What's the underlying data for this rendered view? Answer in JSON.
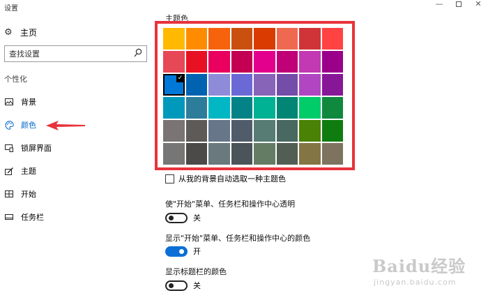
{
  "window": {
    "title": "设置",
    "controls": {
      "minimize": "—",
      "close": "✕"
    }
  },
  "sidebar": {
    "home": {
      "icon": "gear-icon",
      "label": "主页"
    },
    "search": {
      "placeholder": "查找设置",
      "icon": "search-icon"
    },
    "section": "个性化",
    "items": [
      {
        "icon": "picture-icon",
        "label": "背景"
      },
      {
        "icon": "palette-icon",
        "label": "颜色",
        "active": true,
        "accent": "#0066cc"
      },
      {
        "icon": "lock-screen-icon",
        "label": "锁屏界面"
      },
      {
        "icon": "theme-brush-icon",
        "label": "主题"
      },
      {
        "icon": "start-grid-icon",
        "label": "开始"
      },
      {
        "icon": "taskbar-icon",
        "label": "任务栏"
      }
    ]
  },
  "main": {
    "accent_title": "主题色",
    "swatches": [
      [
        "#FFB900",
        "#FF8C00",
        "#F7630C",
        "#CA5010",
        "#DA3B01",
        "#EF6950",
        "#D13438",
        "#FF4343"
      ],
      [
        "#E74856",
        "#E81123",
        "#EA005E",
        "#C30052",
        "#E3008C",
        "#BF0077",
        "#C239B3",
        "#9A0089"
      ],
      [
        "#0078D7",
        "#0063B1",
        "#8E8CD8",
        "#6B69D6",
        "#8764B8",
        "#744DA9",
        "#B146C2",
        "#881798"
      ],
      [
        "#0099BC",
        "#2D7D9A",
        "#00B7C3",
        "#038387",
        "#00B294",
        "#018574",
        "#00CC6A",
        "#10893E"
      ],
      [
        "#7A7574",
        "#5D5A58",
        "#68768A",
        "#515C6B",
        "#567C73",
        "#486860",
        "#498205",
        "#107C10"
      ],
      [
        "#767676",
        "#4C4A48",
        "#69797E",
        "#4A5459",
        "#647C64",
        "#525E54",
        "#847545",
        "#7E735F"
      ]
    ],
    "selected_swatch": {
      "row": 2,
      "col": 0,
      "check": "✓"
    },
    "auto_pick_label": "从我的背景自动选取一种主题色",
    "auto_pick_checked": false,
    "settings": [
      {
        "label": "使\"开始\"菜单、任务栏和操作中心透明",
        "state": "off",
        "state_label": "关"
      },
      {
        "label": "显示\"开始\"菜单、任务栏和操作中心的颜色",
        "state": "on",
        "state_label": "开"
      },
      {
        "label": "显示标题栏的颜色",
        "state": "off",
        "state_label": "关"
      }
    ]
  },
  "colors": {
    "accent_blue": "#0a6fd6",
    "highlight_red": "#e8333b"
  },
  "watermark": {
    "brand": "Baidu经验",
    "sub": "jingyan.baidu.com"
  }
}
